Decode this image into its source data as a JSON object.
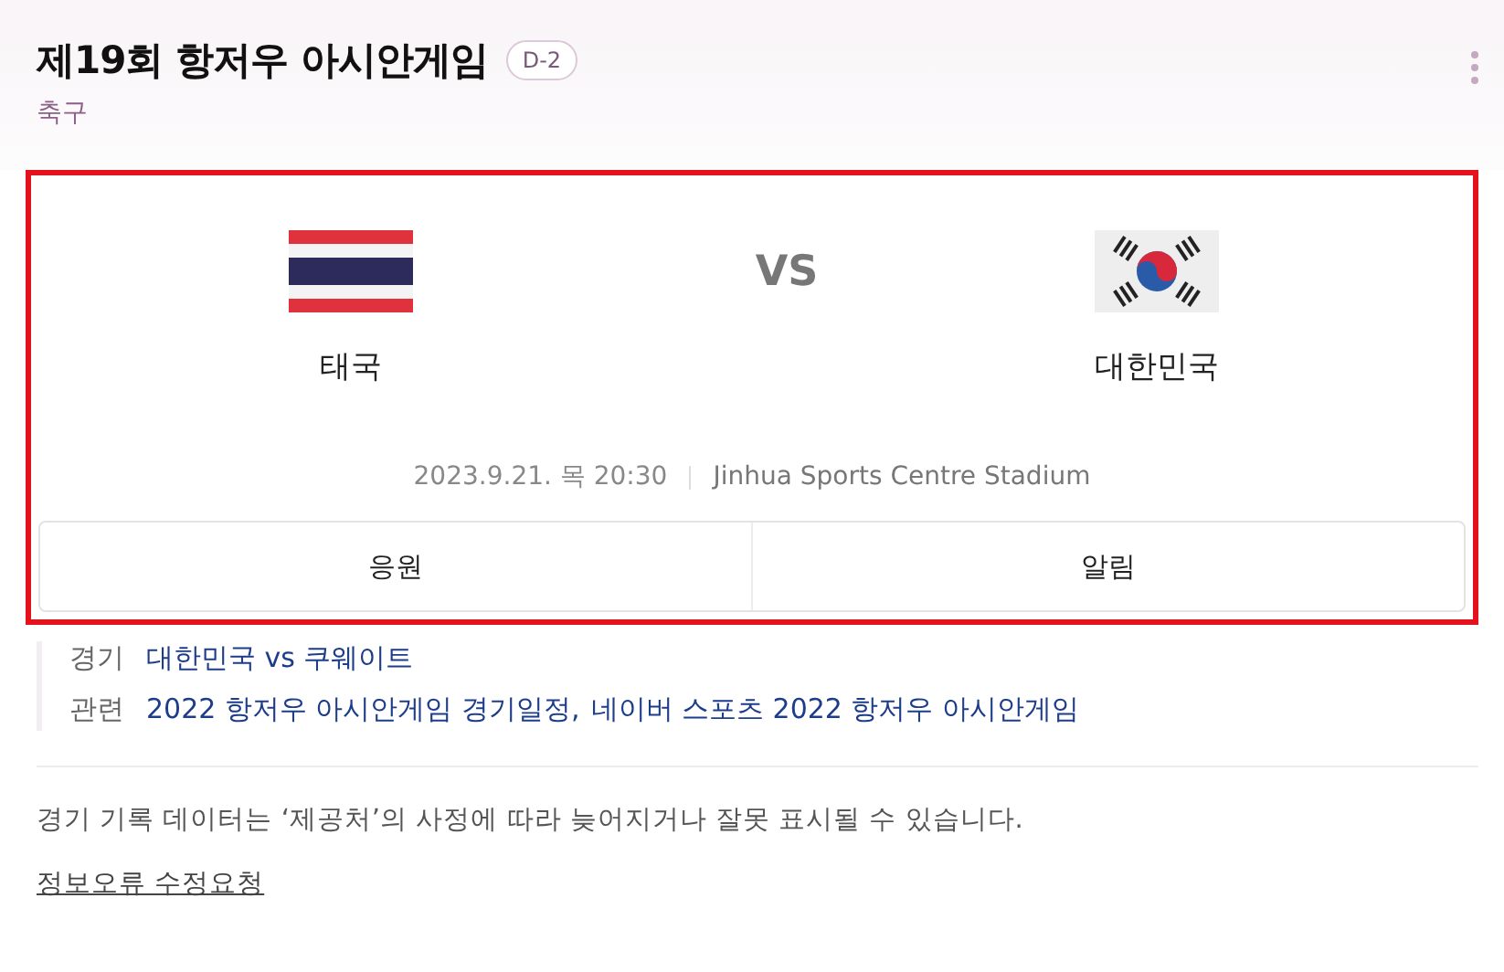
{
  "header": {
    "title": "제19회 항저우 아시안게임",
    "badge": "D-2",
    "subtitle": "축구"
  },
  "match": {
    "highlighted": true,
    "teams": [
      {
        "name": "태국",
        "kind": "thailand"
      },
      {
        "name": "대한민국",
        "kind": "korea"
      }
    ],
    "versus": "VS",
    "datetime": "2023.9.21. 목 20:30",
    "venue": "Jinhua Sports Centre Stadium",
    "buttons": [
      "응원",
      "알림"
    ]
  },
  "info": [
    {
      "label": "경기",
      "links": [
        "대한민국 vs 쿠웨이트"
      ]
    },
    {
      "label": "관련",
      "links": [
        "2022 항저우 아시안게임 경기일정",
        "네이버 스포츠 2022 항저우 아시안게임"
      ],
      "separator": ","
    }
  ],
  "notice": "경기 기록 데이터는 ‘제공처’의 사정에 따라 늦어지거나 잘못 표시될 수 있습니다.",
  "report_link": "정보오류 수정요청"
}
